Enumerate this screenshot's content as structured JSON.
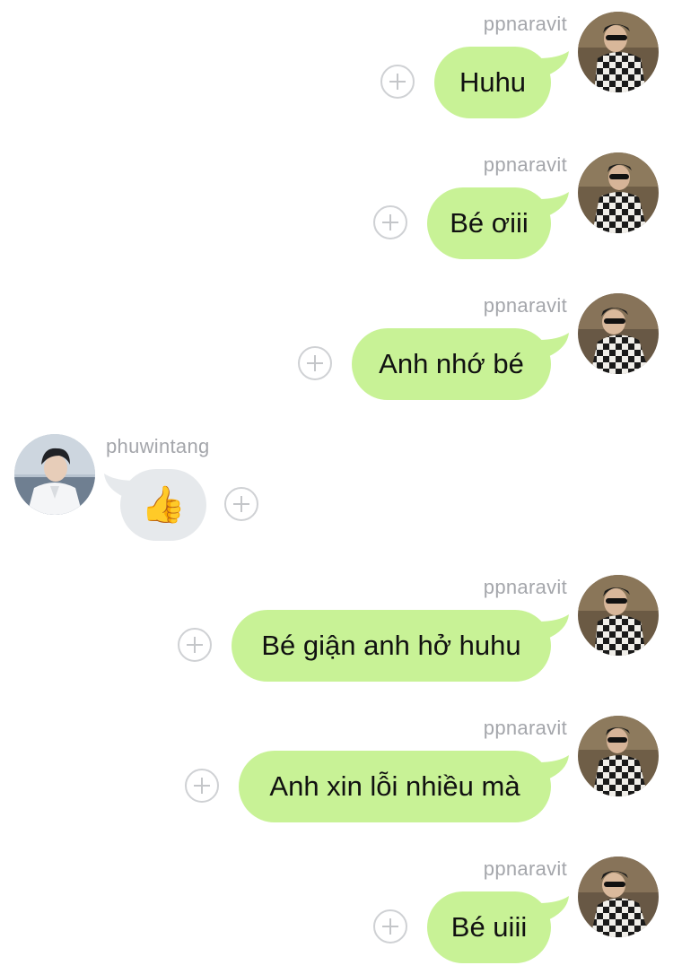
{
  "messages": [
    {
      "sender": "ppnaravit",
      "side": "right",
      "text": "Huhu"
    },
    {
      "sender": "ppnaravit",
      "side": "right",
      "text": "Bé ơiii"
    },
    {
      "sender": "ppnaravit",
      "side": "right",
      "text": "Anh nhớ bé"
    },
    {
      "sender": "phuwintang",
      "side": "left",
      "text": "👍"
    },
    {
      "sender": "ppnaravit",
      "side": "right",
      "text": "Bé giận anh hở huhu"
    },
    {
      "sender": "ppnaravit",
      "side": "right",
      "text": "Anh xin lỗi nhiều mà"
    },
    {
      "sender": "ppnaravit",
      "side": "right",
      "text": "Bé uiii"
    }
  ],
  "icons": {
    "react": "add-reaction-icon",
    "avatar_right": "checkered-shirt-avatar",
    "avatar_left": "white-shirt-avatar"
  },
  "colors": {
    "outgoing_bubble": "#c8f296",
    "incoming_bubble": "#e6e9ec",
    "name_text": "#a4a6ab",
    "react_icon": "#cfd1d4"
  }
}
